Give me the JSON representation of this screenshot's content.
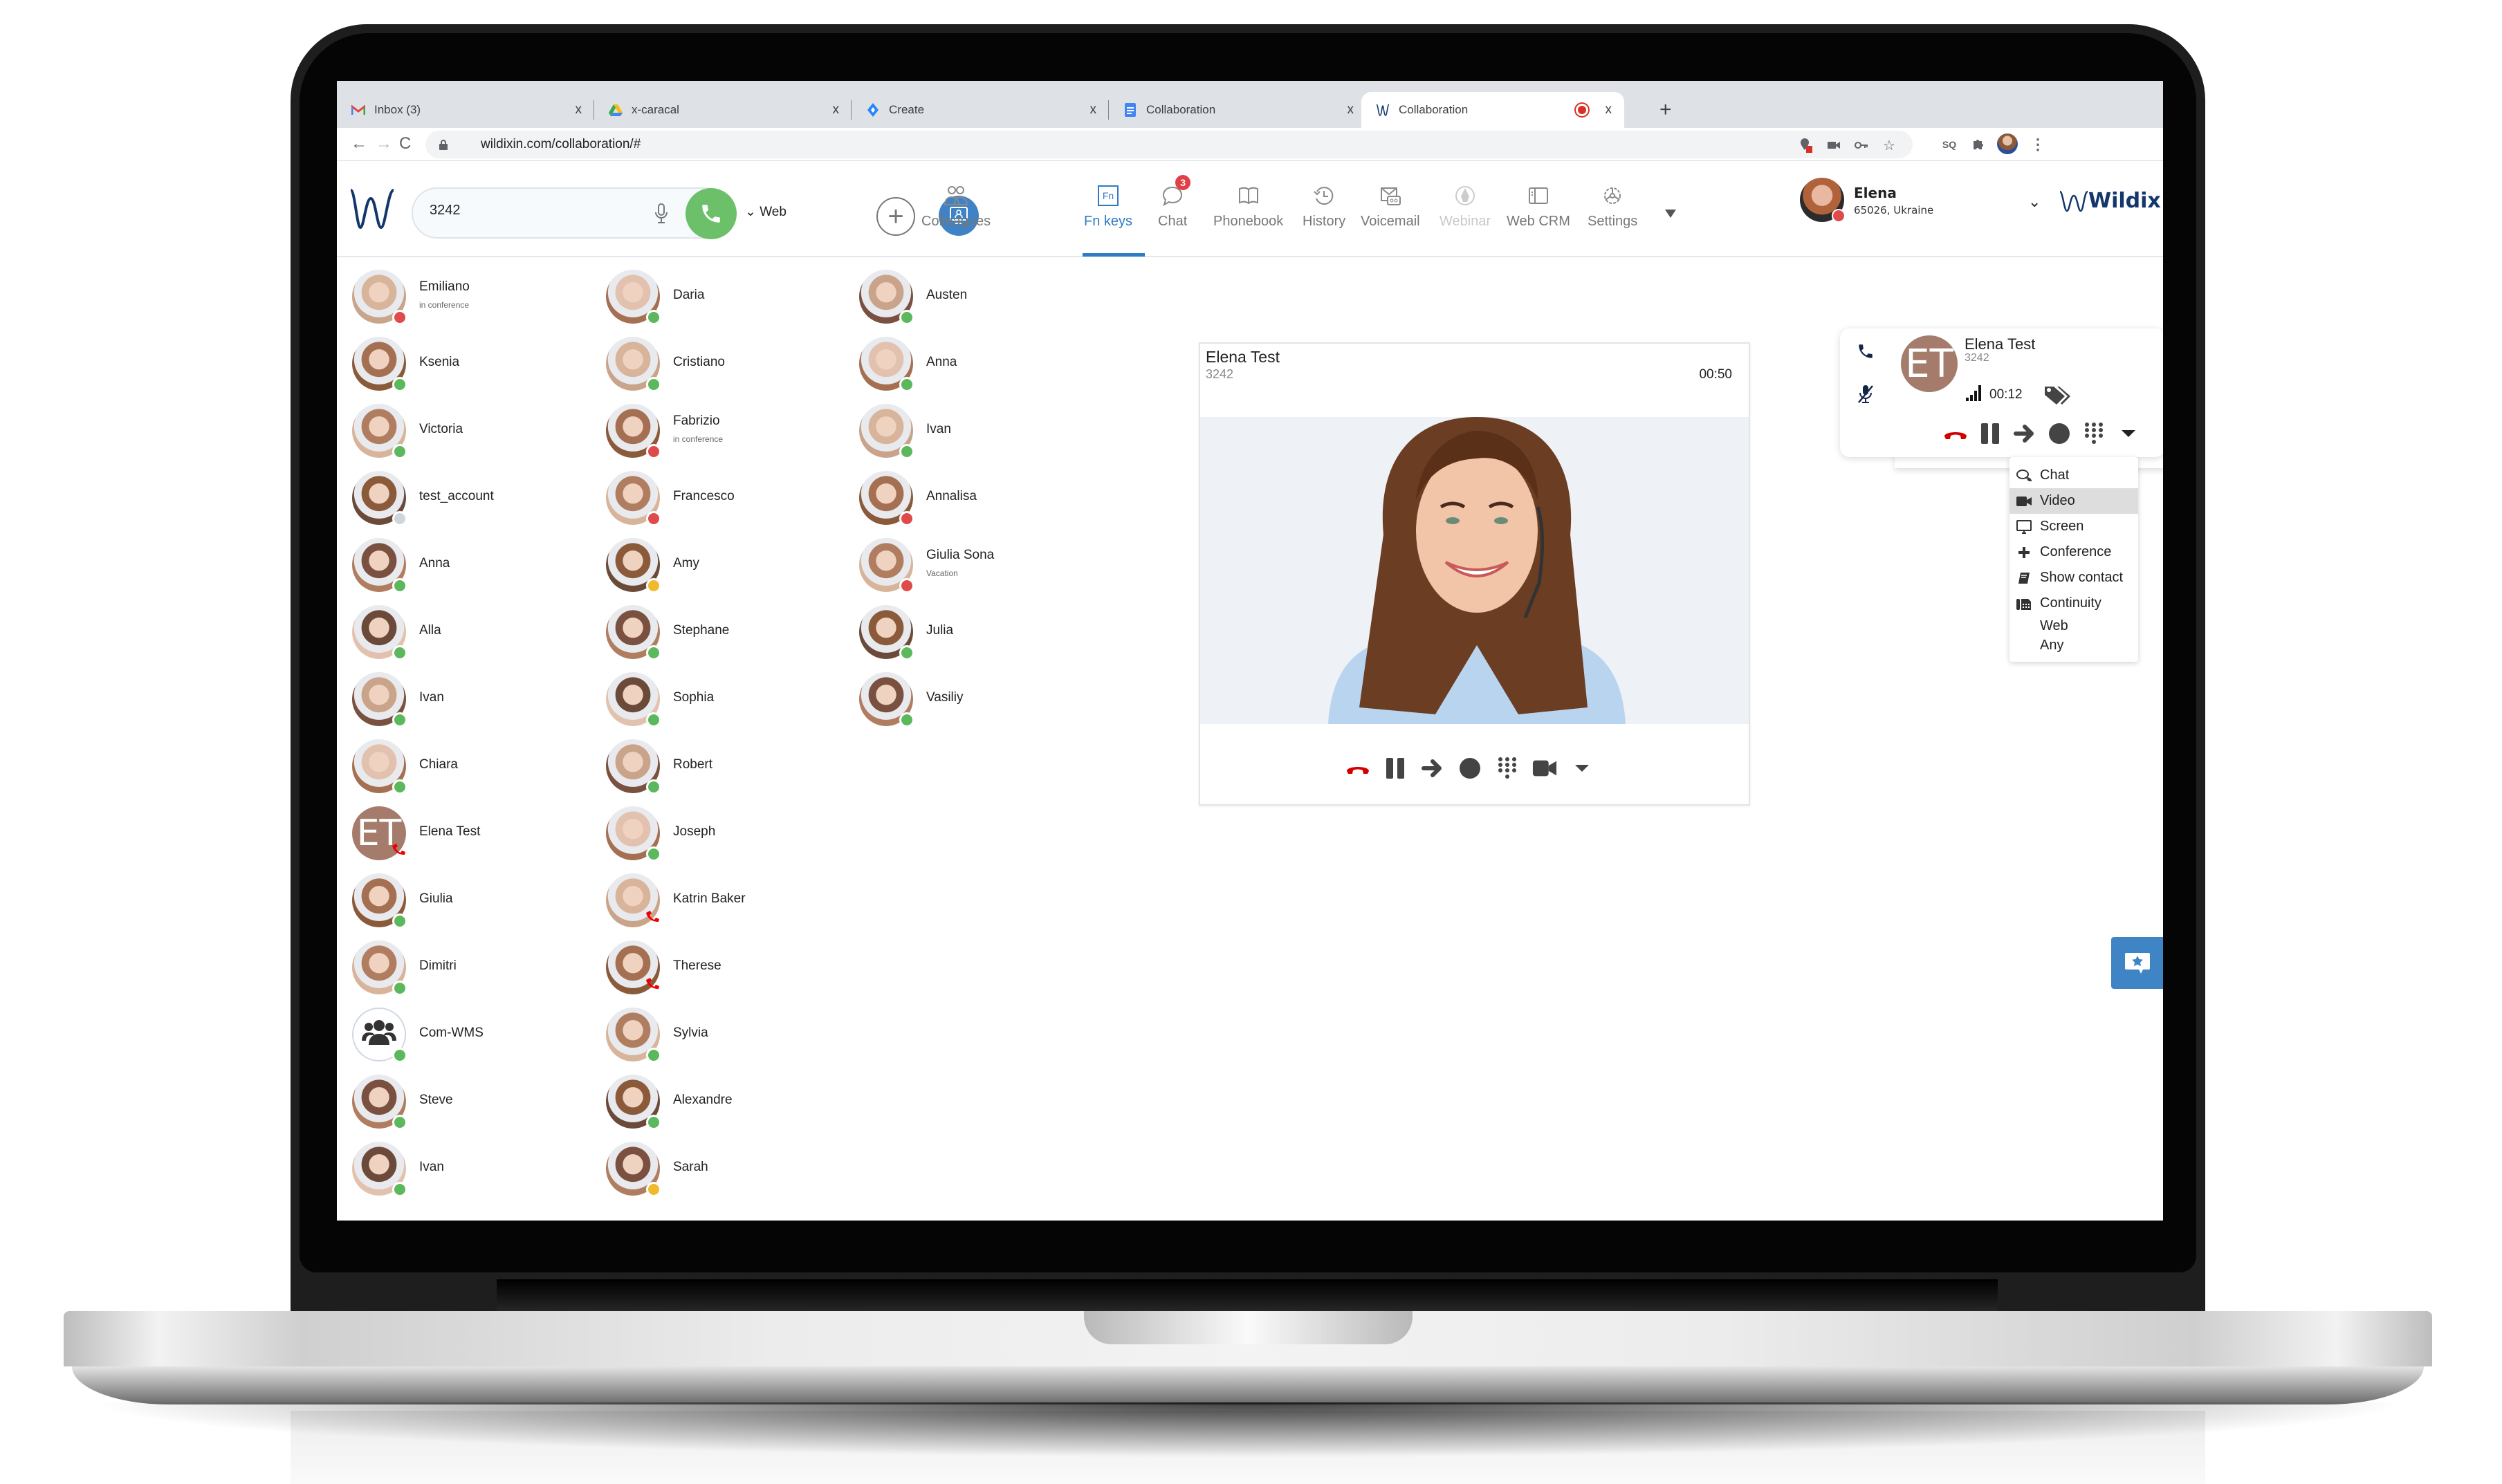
{
  "browser": {
    "tabs": [
      {
        "label": "Inbox (3)",
        "icon": "gmail-icon",
        "active": false
      },
      {
        "label": "x-caracal",
        "icon": "google-drive-icon",
        "active": false
      },
      {
        "label": "Create",
        "icon": "jira-icon",
        "active": false
      },
      {
        "label": "Collaboration",
        "icon": "google-docs-icon",
        "active": false
      },
      {
        "label": "Collaboration",
        "icon": "wildix-icon",
        "active": true,
        "recording": true
      }
    ],
    "close_glyph": "x",
    "new_tab_glyph": "+",
    "url": "wildixin.com/collaboration/#",
    "nav": {
      "back": "←",
      "forward": "→",
      "reload": "C"
    },
    "extensions": [
      "location-blocked-icon",
      "camera-icon",
      "key-icon",
      "star-icon",
      "sq-extension-icon",
      "puzzle-icon",
      "profile-avatar",
      "kebab-menu-icon"
    ]
  },
  "app": {
    "dialer": {
      "value": "3242",
      "placeholder": "",
      "device": "Web",
      "device_chevron": "⌄"
    },
    "nav": [
      {
        "label": "Colleagues",
        "icon": "colleagues-icon",
        "state": "normal"
      },
      {
        "label": "Fn keys",
        "icon": "fn-keys-icon",
        "state": "active"
      },
      {
        "label": "Chat",
        "icon": "chat-icon",
        "state": "normal",
        "badge": "3"
      },
      {
        "label": "Phonebook",
        "icon": "phonebook-icon",
        "state": "normal"
      },
      {
        "label": "History",
        "icon": "history-icon",
        "state": "normal"
      },
      {
        "label": "Voicemail",
        "icon": "voicemail-icon",
        "state": "normal"
      },
      {
        "label": "Webinar",
        "icon": "webinar-icon",
        "state": "disabled"
      },
      {
        "label": "Web CRM",
        "icon": "web-crm-icon",
        "state": "normal"
      },
      {
        "label": "Settings",
        "icon": "settings-icon",
        "state": "normal"
      }
    ],
    "fn_icon_text": "Fn",
    "user": {
      "name": "Elena",
      "location": "65026, Ukraine",
      "status": "busy"
    },
    "brand": "Wildix",
    "colors": {
      "accent": "#2f7bc4",
      "call_green": "#6cc06a",
      "online": "#5cb85c",
      "busy": "#e04a4a",
      "away": "#f0b92e",
      "offline": "#d0d5dc",
      "hangup": "#d40000"
    }
  },
  "contacts": [
    [
      {
        "name": "Emiliano",
        "sub": "in conference",
        "status": "busy"
      },
      {
        "name": "Ksenia",
        "status": "online"
      },
      {
        "name": "Victoria",
        "status": "online"
      },
      {
        "name": "test_account",
        "status": "offline"
      },
      {
        "name": "Anna",
        "status": "online"
      },
      {
        "name": "Alla",
        "status": "online"
      },
      {
        "name": "Ivan",
        "status": "online"
      },
      {
        "name": "Chiara",
        "status": "online"
      },
      {
        "name": "Elena Test",
        "status": "on-call",
        "initials": "ET"
      },
      {
        "name": "Giulia",
        "status": "online"
      },
      {
        "name": "Dimitri",
        "status": "online"
      },
      {
        "name": "Com-WMS",
        "status": "online",
        "group": true
      },
      {
        "name": "Steve",
        "status": "online"
      },
      {
        "name": "Ivan",
        "status": "online"
      }
    ],
    [
      {
        "name": "Daria",
        "status": "online"
      },
      {
        "name": "Cristiano",
        "status": "online"
      },
      {
        "name": "Fabrizio",
        "sub": "in conference",
        "status": "busy"
      },
      {
        "name": "Francesco",
        "status": "busy"
      },
      {
        "name": "Amy",
        "status": "away"
      },
      {
        "name": "Stephane",
        "status": "online"
      },
      {
        "name": "Sophia",
        "status": "online"
      },
      {
        "name": "Robert",
        "status": "online"
      },
      {
        "name": "Joseph",
        "status": "online"
      },
      {
        "name": "Katrin Baker",
        "status": "on-call"
      },
      {
        "name": "Therese",
        "status": "on-call"
      },
      {
        "name": "Sylvia",
        "status": "online"
      },
      {
        "name": "Alexandre",
        "status": "online"
      },
      {
        "name": "Sarah",
        "status": "away"
      }
    ],
    [
      {
        "name": "Austen",
        "status": "online"
      },
      {
        "name": "Anna",
        "status": "online"
      },
      {
        "name": "Ivan",
        "status": "online"
      },
      {
        "name": "Annalisa",
        "status": "busy"
      },
      {
        "name": "Giulia Sona",
        "sub": "Vacation",
        "status": "busy"
      },
      {
        "name": "Julia",
        "status": "online"
      },
      {
        "name": "Vasiliy",
        "status": "online"
      }
    ]
  ],
  "video_call": {
    "name": "Elena Test",
    "number": "3242",
    "duration": "00:50",
    "controls": [
      "hangup-icon",
      "hold-icon",
      "transfer-icon",
      "record-icon",
      "dialpad-icon",
      "video-icon",
      "more-dropdown-icon"
    ]
  },
  "call_widget": {
    "initials": "ET",
    "name": "Elena Test",
    "number": "3242",
    "duration": "00:12",
    "controls": [
      "hangup-icon",
      "hold-icon",
      "transfer-icon",
      "record-icon",
      "dialpad-icon",
      "more-dropdown-icon"
    ],
    "menu": [
      {
        "label": "Chat",
        "icon": "chat-bubbles-icon"
      },
      {
        "label": "Video",
        "icon": "video-camera-icon",
        "highlighted": true
      },
      {
        "label": "Screen",
        "icon": "monitor-icon"
      },
      {
        "label": "Conference",
        "icon": "plus-icon"
      },
      {
        "label": "Show contact",
        "icon": "book-icon"
      },
      {
        "label": "Continuity",
        "icon": "desk-phone-icon"
      },
      {
        "label": "Web",
        "icon": ""
      },
      {
        "label": "Any",
        "icon": ""
      }
    ]
  }
}
